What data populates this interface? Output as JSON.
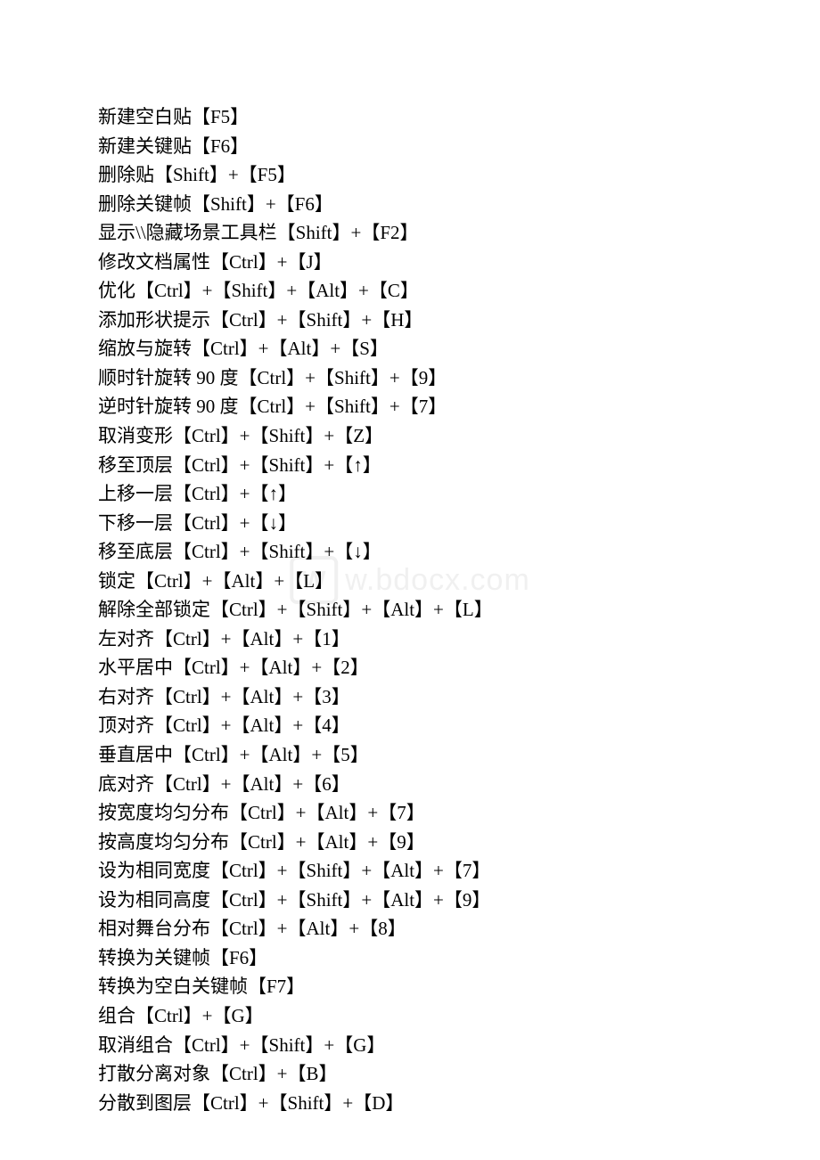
{
  "watermark": {
    "logo_text": "W",
    "site_text": "w.bdocx.com"
  },
  "shortcuts": [
    "新建空白贴【F5】",
    "新建关键贴【F6】",
    "删除贴【Shift】+【F5】",
    "删除关键帧【Shift】+【F6】",
    "显示\\\\隐藏场景工具栏【Shift】+【F2】",
    "修改文档属性【Ctrl】+【J】",
    "优化【Ctrl】+【Shift】+【Alt】+【C】",
    "添加形状提示【Ctrl】+【Shift】+【H】",
    "缩放与旋转【Ctrl】+【Alt】+【S】",
    "顺时针旋转 90 度【Ctrl】+【Shift】+【9】",
    "逆时针旋转 90 度【Ctrl】+【Shift】+【7】",
    "取消变形【Ctrl】+【Shift】+【Z】",
    "移至顶层【Ctrl】+【Shift】+【↑】",
    "上移一层【Ctrl】+【↑】",
    "下移一层【Ctrl】+【↓】",
    "移至底层【Ctrl】+【Shift】+【↓】",
    "锁定【Ctrl】+【Alt】+【L】",
    "解除全部锁定【Ctrl】+【Shift】+【Alt】+【L】",
    "左对齐【Ctrl】+【Alt】+【1】",
    "水平居中【Ctrl】+【Alt】+【2】",
    "右对齐【Ctrl】+【Alt】+【3】",
    "顶对齐【Ctrl】+【Alt】+【4】",
    "垂直居中【Ctrl】+【Alt】+【5】",
    "底对齐【Ctrl】+【Alt】+【6】",
    "按宽度均匀分布【Ctrl】+【Alt】+【7】",
    "按高度均匀分布【Ctrl】+【Alt】+【9】",
    "设为相同宽度【Ctrl】+【Shift】+【Alt】+【7】",
    "设为相同高度【Ctrl】+【Shift】+【Alt】+【9】",
    "相对舞台分布【Ctrl】+【Alt】+【8】",
    "转换为关键帧【F6】",
    "转换为空白关键帧【F7】",
    "组合【Ctrl】+【G】",
    "取消组合【Ctrl】+【Shift】+【G】",
    "打散分离对象【Ctrl】+【B】",
    "分散到图层【Ctrl】+【Shift】+【D】"
  ]
}
